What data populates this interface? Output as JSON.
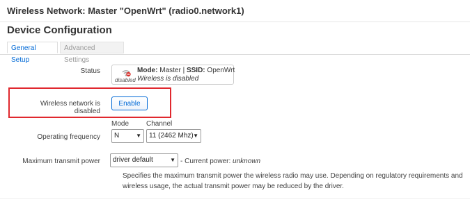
{
  "page": {
    "title": "Wireless Network: Master \"OpenWrt\" (radio0.network1)",
    "section_title": "Device Configuration"
  },
  "tabs": [
    {
      "label": "General Setup",
      "active": true
    },
    {
      "label": "Advanced Settings",
      "active": false
    }
  ],
  "status": {
    "label": "Status",
    "icon": "wifi-disabled-icon",
    "icon_caption": "disabled",
    "mode_key": "Mode:",
    "mode_value": "Master",
    "separator": "|",
    "ssid_key": "SSID:",
    "ssid_value": "OpenWrt",
    "state_text": "Wireless is disabled"
  },
  "enable_row": {
    "label": "Wireless network is disabled",
    "button_label": "Enable",
    "highlight_color": "#e0282e"
  },
  "frequency": {
    "label": "Operating frequency",
    "mode_label": "Mode",
    "mode_value": "N",
    "channel_label": "Channel",
    "channel_value": "11 (2462 Mhz)"
  },
  "tx_power": {
    "label": "Maximum transmit power",
    "value": "driver default",
    "current_prefix": "- Current power:",
    "current_value": "unknown",
    "description": "Specifies the maximum transmit power the wireless radio may use. Depending on regulatory requirements and wireless usage, the actual transmit power may be reduced by the driver."
  },
  "colors": {
    "accent": "#0069d6"
  }
}
